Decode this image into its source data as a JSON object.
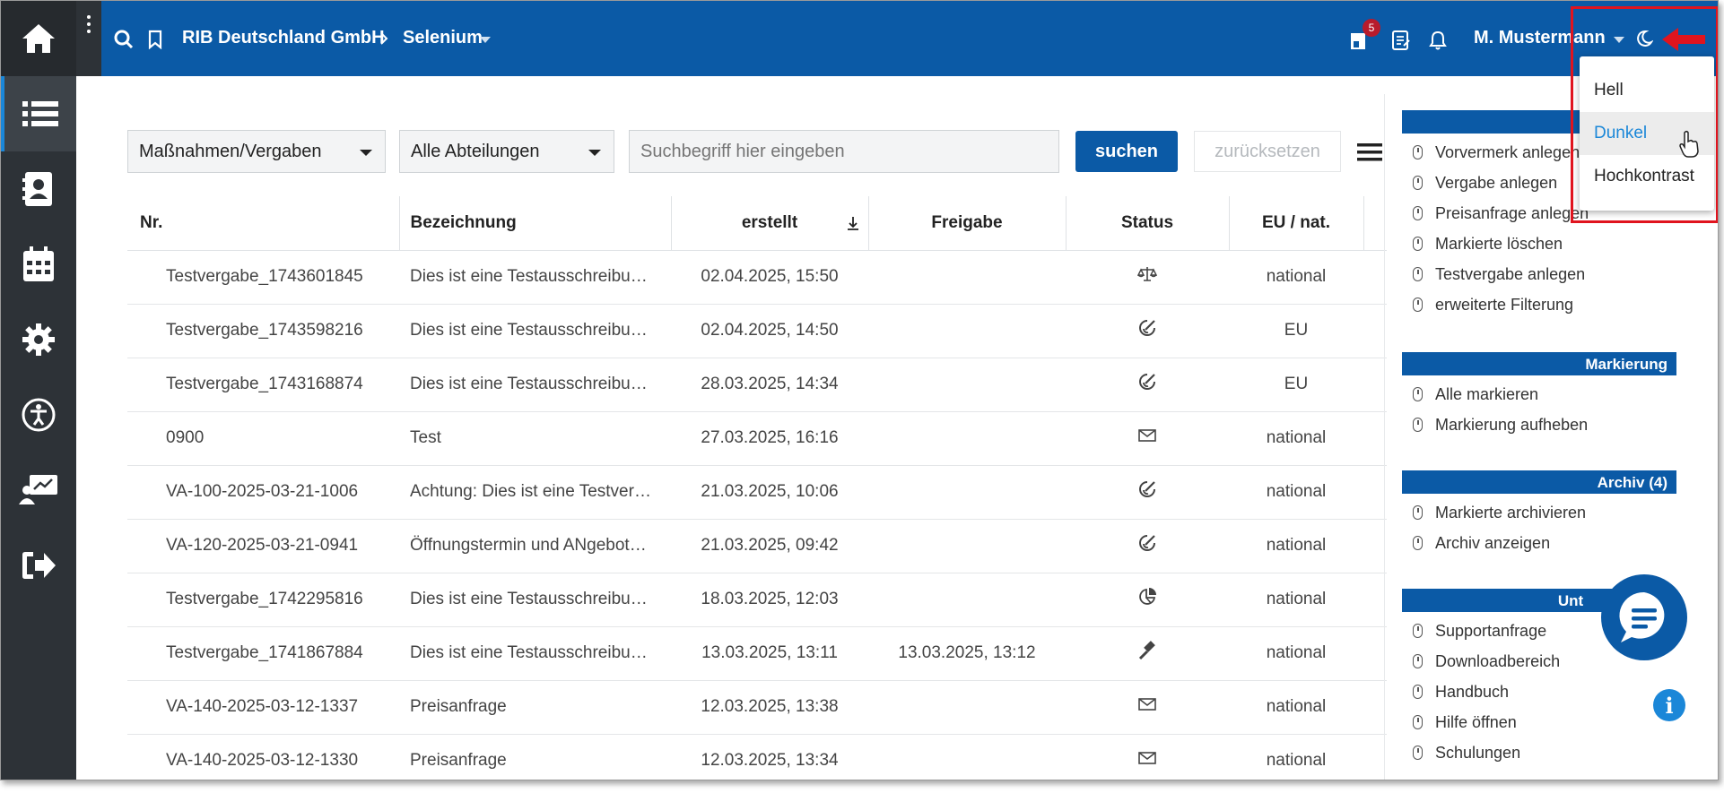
{
  "header": {
    "company": "RIB Deutschland GmbH",
    "project": "Selenium",
    "notifications_count": "5",
    "user": "M. Mustermann"
  },
  "theme_menu": {
    "options": [
      "Hell",
      "Dunkel",
      "Hochkontrast"
    ],
    "hovered": "Dunkel"
  },
  "filters": {
    "type": "Maßnahmen/Vergaben",
    "department": "Alle Abteilungen",
    "search_placeholder": "Suchbegriff hier eingeben",
    "search_button": "suchen",
    "reset_button": "zurücksetzen"
  },
  "table": {
    "columns": [
      "Nr.",
      "Bezeichnung",
      "erstellt",
      "Freigabe",
      "Status",
      "EU / nat."
    ],
    "rows": [
      {
        "nr": "Testvergabe_1743601845",
        "bez": "Dies ist eine Testausschreibu…",
        "erstellt": "02.04.2025, 15:50",
        "freigabe": "",
        "status": "scale",
        "eu": "national"
      },
      {
        "nr": "Testvergabe_1743598216",
        "bez": "Dies ist eine Testausschreibu…",
        "erstellt": "02.04.2025, 14:50",
        "freigabe": "",
        "status": "sign",
        "eu": "EU"
      },
      {
        "nr": "Testvergabe_1743168874",
        "bez": "Dies ist eine Testausschreibu…",
        "erstellt": "28.03.2025, 14:34",
        "freigabe": "",
        "status": "sign",
        "eu": "EU"
      },
      {
        "nr": "0900",
        "bez": "Test",
        "erstellt": "27.03.2025, 16:16",
        "freigabe": "",
        "status": "mail",
        "eu": "national"
      },
      {
        "nr": "VA-100-2025-03-21-1006",
        "bez": "Achtung: Dies ist eine Testver…",
        "erstellt": "21.03.2025, 10:06",
        "freigabe": "",
        "status": "sign",
        "eu": "national"
      },
      {
        "nr": "VA-120-2025-03-21-0941",
        "bez": "Öffnungstermin und ANgebot…",
        "erstellt": "21.03.2025, 09:42",
        "freigabe": "",
        "status": "sign",
        "eu": "national"
      },
      {
        "nr": "Testvergabe_1742295816",
        "bez": "Dies ist eine Testausschreibu…",
        "erstellt": "18.03.2025, 12:03",
        "freigabe": "",
        "status": "pie",
        "eu": "national"
      },
      {
        "nr": "Testvergabe_1741867884",
        "bez": "Dies ist eine Testausschreibu…",
        "erstellt": "13.03.2025, 13:11",
        "freigabe": "13.03.2025, 13:12",
        "status": "gavel",
        "eu": "national"
      },
      {
        "nr": "VA-140-2025-03-12-1337",
        "bez": "Preisanfrage",
        "erstellt": "12.03.2025, 13:38",
        "freigabe": "",
        "status": "mail",
        "eu": "national"
      },
      {
        "nr": "VA-140-2025-03-12-1330",
        "bez": "Preisanfrage",
        "erstellt": "12.03.2025, 13:34",
        "freigabe": "",
        "status": "mail",
        "eu": "national"
      }
    ]
  },
  "sidebar_right": {
    "actions": [
      "Vorvermerk anlegen",
      "Vergabe anlegen",
      "Preisanfrage anlegen",
      "Markierte löschen",
      "Testvergabe anlegen",
      "erweiterte Filterung"
    ],
    "markierung": {
      "title": "Markierung",
      "items": [
        "Alle markieren",
        "Markierung aufheben"
      ]
    },
    "archiv": {
      "title": "Archiv (4)",
      "items": [
        "Markierte archivieren",
        "Archiv anzeigen"
      ]
    },
    "unterstuetzung": {
      "title": "Unt",
      "items": [
        "Supportanfrage",
        "Downloadbereich",
        "Handbuch",
        "Hilfe öffnen",
        "Schulungen"
      ]
    }
  },
  "colors": {
    "primary": "#0b5aa6",
    "sidebar": "#2d3237",
    "highlight": "#e0141e",
    "accent": "#1b87d8"
  }
}
